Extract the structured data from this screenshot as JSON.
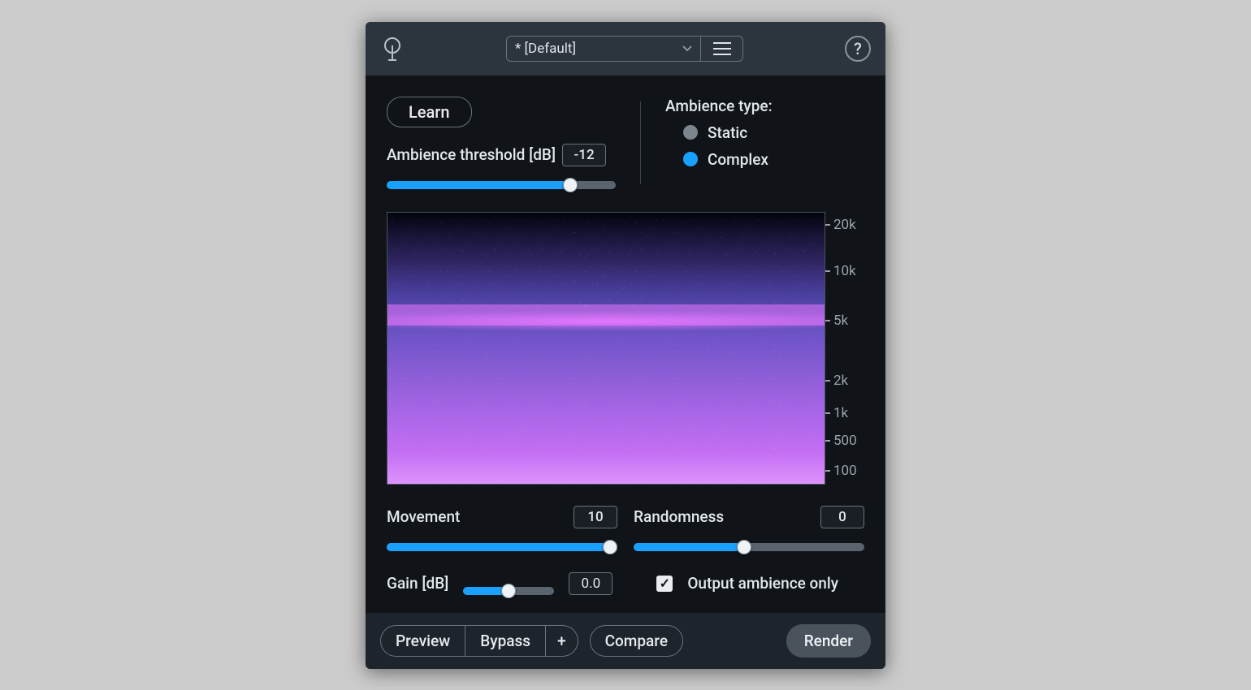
{
  "header": {
    "preset_label": "* [Default]"
  },
  "controls": {
    "learn_label": "Learn",
    "threshold_label": "Ambience threshold [dB]",
    "threshold_value": "-12",
    "threshold_percent": 80,
    "ambience_type_label": "Ambience type:",
    "type_static_label": "Static",
    "type_complex_label": "Complex",
    "type_selected": "complex",
    "movement_label": "Movement",
    "movement_value": "10",
    "movement_percent": 97,
    "randomness_label": "Randomness",
    "randomness_value": "0",
    "randomness_percent": 48,
    "gain_label": "Gain [dB]",
    "gain_value": "0.0",
    "gain_percent": 50,
    "output_only_label": "Output ambience only",
    "output_only_checked": true
  },
  "freq_ticks": [
    {
      "label": "20k",
      "pos": 5
    },
    {
      "label": "10k",
      "pos": 22
    },
    {
      "label": "5k",
      "pos": 40
    },
    {
      "label": "2k",
      "pos": 62
    },
    {
      "label": "1k",
      "pos": 74
    },
    {
      "label": "500",
      "pos": 84
    },
    {
      "label": "100",
      "pos": 95
    }
  ],
  "footer": {
    "preview_label": "Preview",
    "bypass_label": "Bypass",
    "plus_label": "+",
    "compare_label": "Compare",
    "render_label": "Render"
  }
}
